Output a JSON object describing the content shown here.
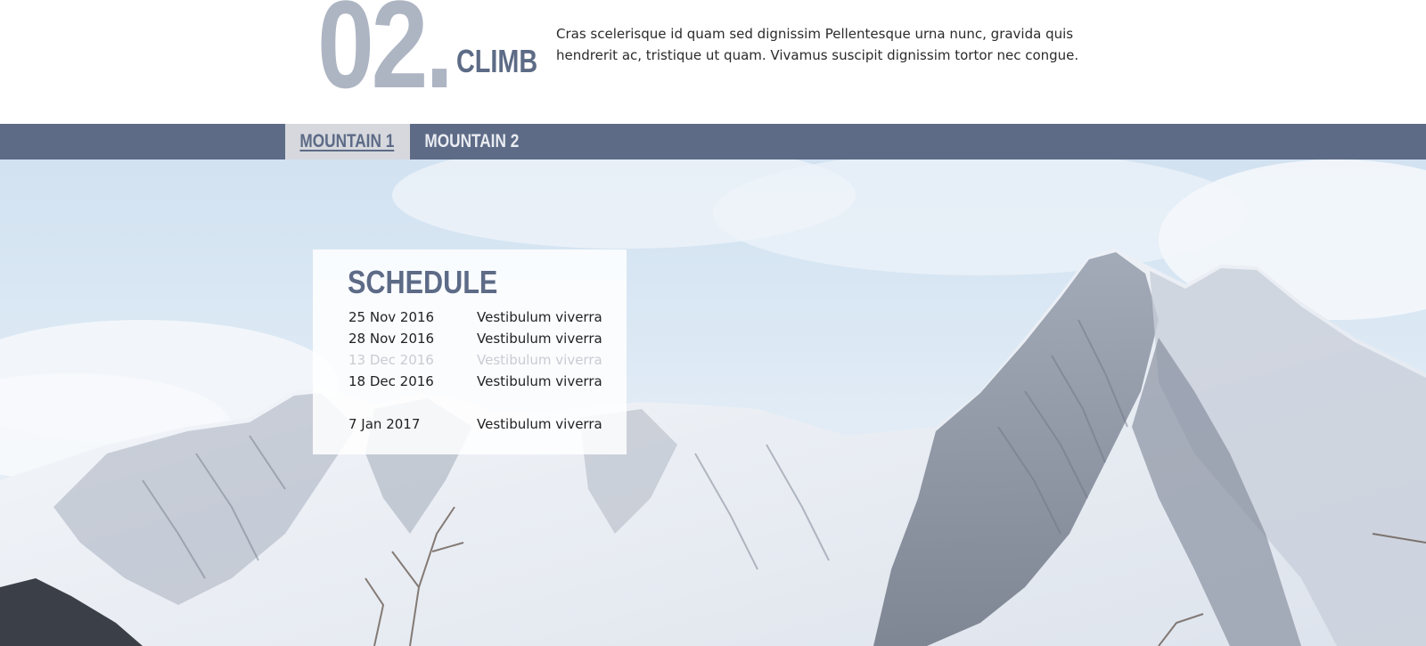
{
  "section": {
    "number": "02.",
    "title": "CLIMB",
    "description": "Cras scelerisque id quam sed dignissim Pellentesque urna nunc, gravida quis hendrerit ac, tristique ut quam. Vivamus suscipit dignissim tortor nec congue."
  },
  "tabs": [
    {
      "label": "MOUNTAIN 1",
      "active": true
    },
    {
      "label": "MOUNTAIN 2",
      "active": false
    }
  ],
  "schedule": {
    "title": "SCHEDULE",
    "rows": [
      {
        "date": "25 Nov 2016",
        "event": "Vestibulum viverra"
      },
      {
        "date": "28 Nov 2016",
        "event": "Vestibulum viverra"
      },
      {
        "date": "13 Dec 2016",
        "event": "Vestibulum viverra",
        "faded": true
      },
      {
        "date": "18 Dec 2016",
        "event": "Vestibulum viverra"
      },
      {
        "date": "7 Jan 2017",
        "event": "Vestibulum viverra"
      }
    ]
  },
  "colors": {
    "accent": "#5d6b87",
    "number_gray": "#adb5c3",
    "active_tab_bg": "#d6d8dd"
  }
}
